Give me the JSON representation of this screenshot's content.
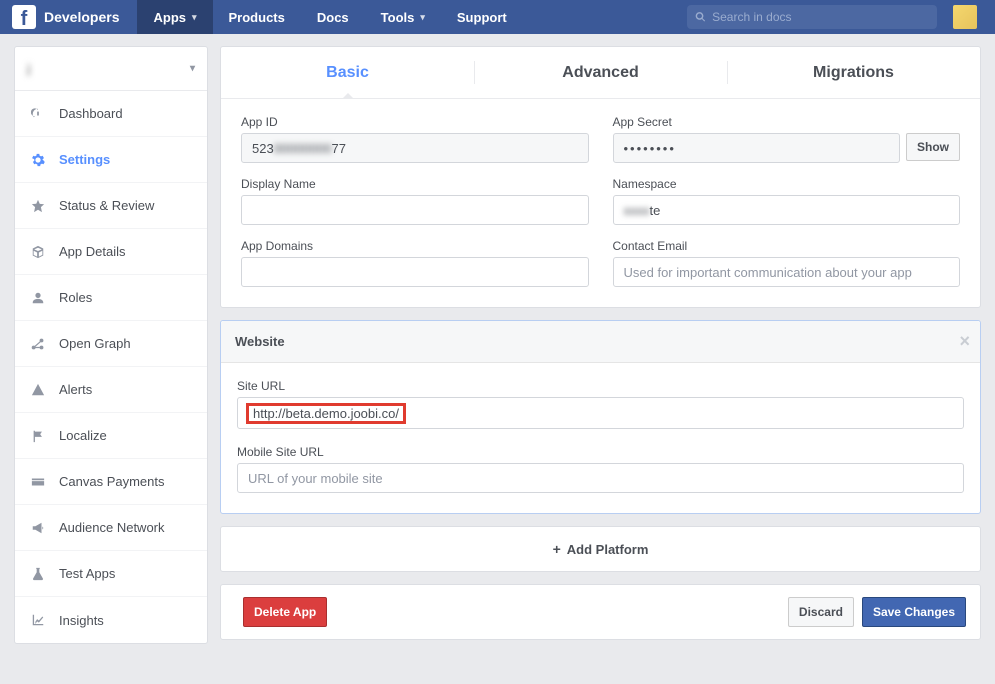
{
  "topnav": {
    "brand": "Developers",
    "items": [
      "Apps",
      "Products",
      "Docs",
      "Tools",
      "Support"
    ],
    "search_placeholder": "Search in docs"
  },
  "sidebar": {
    "app_name": "j",
    "items": [
      {
        "label": "Dashboard"
      },
      {
        "label": "Settings"
      },
      {
        "label": "Status & Review"
      },
      {
        "label": "App Details"
      },
      {
        "label": "Roles"
      },
      {
        "label": "Open Graph"
      },
      {
        "label": "Alerts"
      },
      {
        "label": "Localize"
      },
      {
        "label": "Canvas Payments"
      },
      {
        "label": "Audience Network"
      },
      {
        "label": "Test Apps"
      },
      {
        "label": "Insights"
      }
    ]
  },
  "tabs": {
    "basic": "Basic",
    "advanced": "Advanced",
    "migrations": "Migrations"
  },
  "basic": {
    "app_id_label": "App ID",
    "app_id_prefix": "523",
    "app_id_suffix": "77",
    "app_secret_label": "App Secret",
    "app_secret_mask": "••••••••",
    "show": "Show",
    "display_name_label": "Display Name",
    "display_name_value": "",
    "namespace_label": "Namespace",
    "namespace_suffix": "te",
    "app_domains_label": "App Domains",
    "app_domains_value": "",
    "contact_email_label": "Contact Email",
    "contact_email_placeholder": "Used for important communication about your app",
    "contact_email_value": ""
  },
  "website": {
    "heading": "Website",
    "site_url_label": "Site URL",
    "site_url_value": "http://beta.demo.joobi.co/",
    "mobile_site_url_label": "Mobile Site URL",
    "mobile_site_url_placeholder": "URL of your mobile site",
    "mobile_site_url_value": ""
  },
  "add_platform": "Add Platform",
  "footer": {
    "delete": "Delete App",
    "discard": "Discard",
    "save": "Save Changes"
  }
}
